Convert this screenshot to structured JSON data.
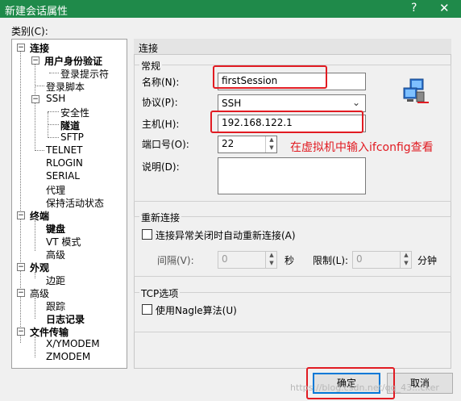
{
  "window": {
    "title": "新建会话属性",
    "help": "?",
    "close": "✕"
  },
  "category_label": "类别(C):",
  "tree": {
    "connection": "连接",
    "user_auth": "用户身份验证",
    "login_prompt": "登录提示符",
    "login_script": "登录脚本",
    "ssh": "SSH",
    "security": "安全性",
    "tunnel": "隧道",
    "sftp": "SFTP",
    "telnet": "TELNET",
    "rlogin": "RLOGIN",
    "serial": "SERIAL",
    "proxy": "代理",
    "keepalive": "保持活动状态",
    "terminal": "终端",
    "keyboard": "键盘",
    "vt_mode": "VT 模式",
    "advanced1": "高级",
    "appearance": "外观",
    "margin": "边距",
    "advanced2": "高级",
    "trace": "跟踪",
    "logging": "日志记录",
    "file_transfer": "文件传输",
    "xymodem": "X/YMODEM",
    "zmodem": "ZMODEM"
  },
  "panel": {
    "section": "连接",
    "general": {
      "title": "常规",
      "name_label": "名称(N):",
      "name_value": "firstSession",
      "protocol_label": "协议(P):",
      "protocol_value": "SSH",
      "host_label": "主机(H):",
      "host_value": "192.168.122.1",
      "port_label": "端口号(O):",
      "port_value": "22",
      "desc_label": "说明(D):",
      "desc_value": ""
    },
    "reconnect": {
      "title": "重新连接",
      "checkbox_label": "连接异常关闭时自动重新连接(A)",
      "interval_label": "间隔(V):",
      "interval_value": "0",
      "seconds": "秒",
      "limit_label": "限制(L):",
      "limit_value": "0",
      "minutes": "分钟"
    },
    "tcp": {
      "title": "TCP选项",
      "nagle_label": "使用Nagle算法(U)"
    }
  },
  "buttons": {
    "ok": "确定",
    "cancel": "取消"
  },
  "annotation": "在虚拟机中输入ifconfig查看",
  "watermark": "https://blog.csdn.net/qq_43...cker",
  "colors": {
    "titlebar": "#1f8a4a",
    "annotation": "#e11b22"
  },
  "icons": {
    "session": "network-computers-icon"
  }
}
